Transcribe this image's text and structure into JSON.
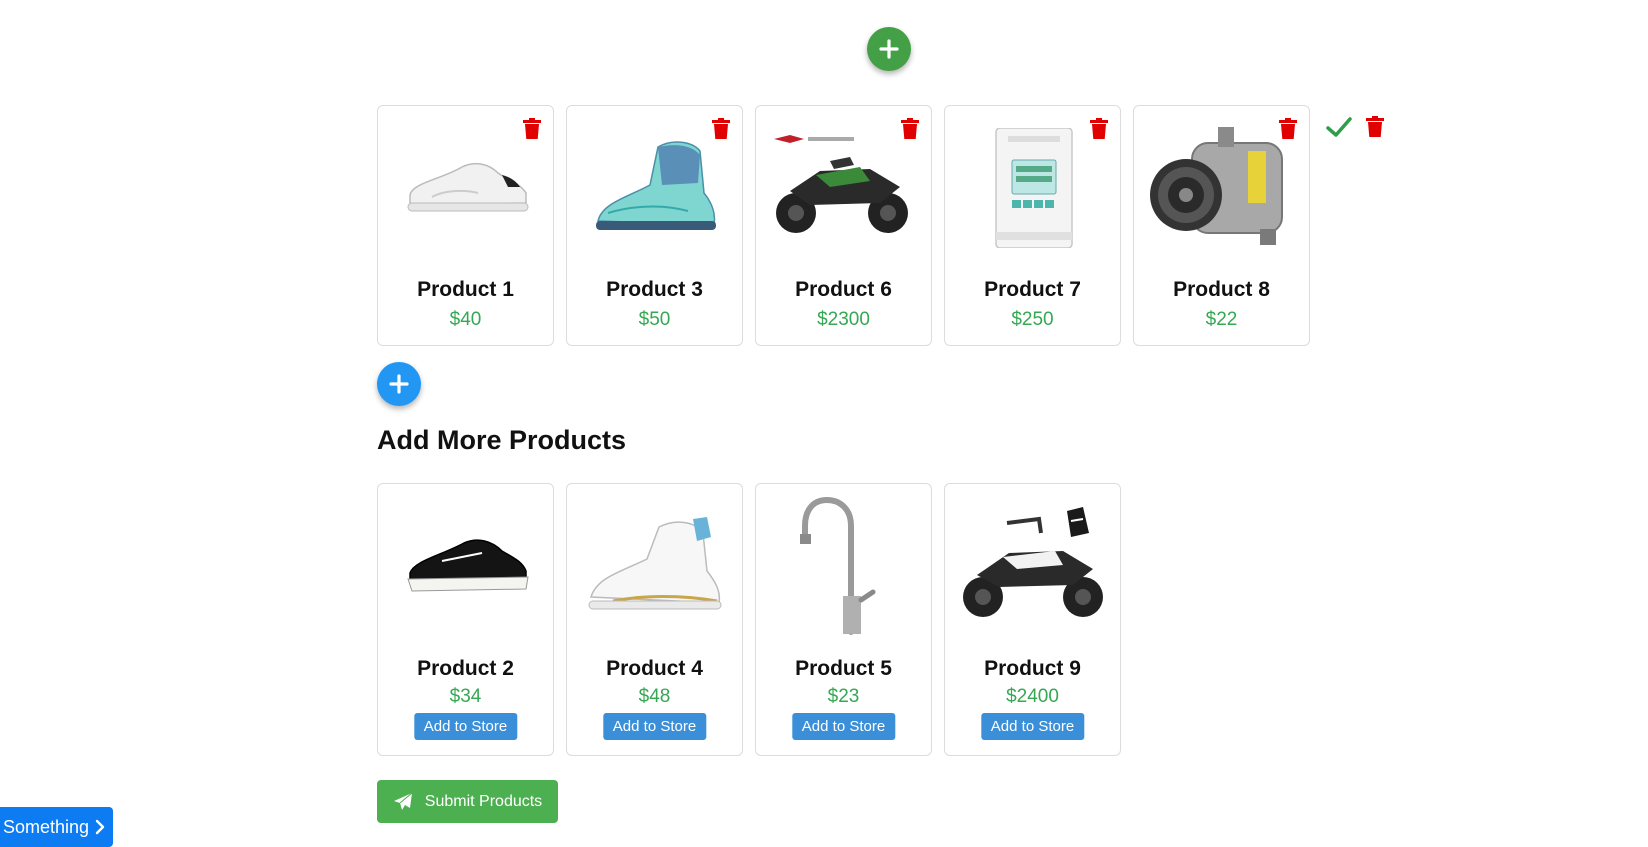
{
  "store_products": [
    {
      "name": "Product 1",
      "price": "$40",
      "image": "white-sneaker"
    },
    {
      "name": "Product 3",
      "price": "$50",
      "image": "teal-basketball-shoe"
    },
    {
      "name": "Product 6",
      "price": "$2300",
      "image": "green-black-atv"
    },
    {
      "name": "Product 7",
      "price": "$250",
      "image": "din-rail-energy-meter"
    },
    {
      "name": "Product 8",
      "price": "$22",
      "image": "ac-compressor"
    }
  ],
  "more_products": {
    "title": "Add More Products",
    "items": [
      {
        "name": "Product 2",
        "price": "$34",
        "image": "black-sneaker",
        "button": "Add to Store"
      },
      {
        "name": "Product 4",
        "price": "$48",
        "image": "white-gold-basketball-shoe",
        "button": "Add to Store"
      },
      {
        "name": "Product 5",
        "price": "$23",
        "image": "kitchen-faucet",
        "button": "Add to Store"
      },
      {
        "name": "Product 9",
        "price": "$2400",
        "image": "white-black-atv",
        "button": "Add to Store"
      }
    ]
  },
  "submit_label": "Submit Products",
  "something_label": "Something",
  "colors": {
    "green_fab": "#43a047",
    "blue_fab": "#2196f3",
    "price_green": "#34a853",
    "trash_red": "#e00000",
    "add_button_blue": "#3a8fd8",
    "submit_green": "#4caf50",
    "something_blue": "#0d7bf2"
  }
}
